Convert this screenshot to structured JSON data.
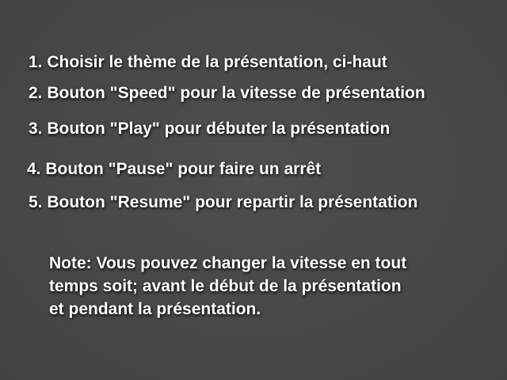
{
  "instructions": {
    "steps": [
      "1. Choisir le thème de la présentation, ci-haut",
      "2. Bouton \"Speed\" pour la vitesse de présentation",
      "3. Bouton \"Play\" pour débuter la présentation",
      "4. Bouton \"Pause\" pour faire un arrêt",
      "5. Bouton \"Resume\" pour repartir la présentation"
    ],
    "note_lines": [
      "Note: Vous pouvez changer la vitesse  en tout",
      "temps soit; avant le début de la présentation",
      "et pendant la présentation."
    ]
  },
  "colors": {
    "background": "#474747",
    "text": "#ffffff"
  }
}
